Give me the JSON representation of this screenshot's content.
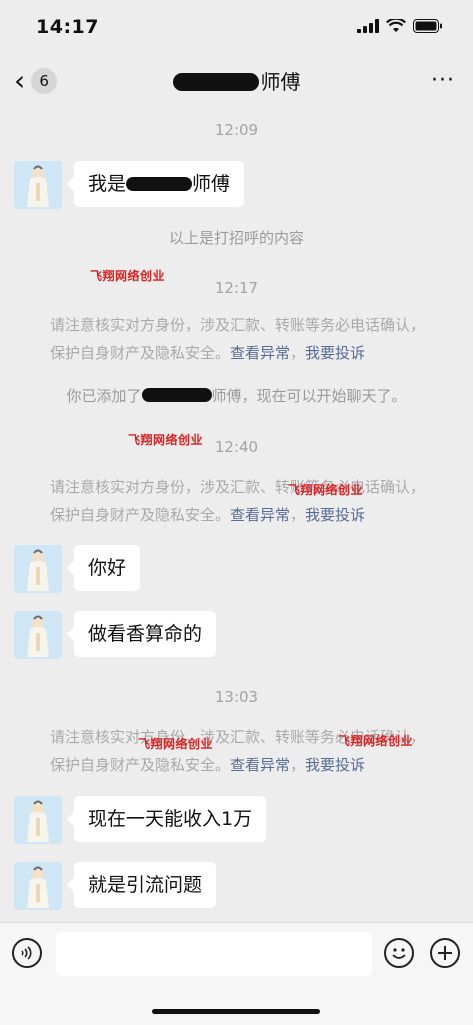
{
  "status_bar": {
    "time": "14:17"
  },
  "nav": {
    "unread_count": "6",
    "title_suffix": "师傅",
    "more": "···"
  },
  "messages": {
    "t1": "12:09",
    "m1_prefix": "我是",
    "m1_suffix": "师傅",
    "sys_greeting": "以上是打招呼的内容",
    "t2": "12:17",
    "notice_text": "请注意核实对方身份，涉及汇款、转账等务必电话确认，保护自身财产及隐私安全。",
    "notice_link_check": "查看异常",
    "notice_link_sep": "，",
    "notice_link_report": "我要投诉",
    "added_prefix": "你已添加了",
    "added_suffix": "师傅，现在可以开始聊天了。",
    "t3": "12:40",
    "m2": "你好",
    "m3": "做看香算命的",
    "t4": "13:03",
    "m4": "现在一天能收入1万",
    "m5": "就是引流问题"
  },
  "watermark": "飞翔网络创业",
  "colors": {
    "background": "#ededed",
    "bubble": "#ffffff",
    "link": "#576b95",
    "watermark": "#e02020"
  }
}
